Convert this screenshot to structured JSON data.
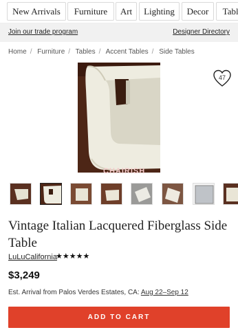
{
  "categories": [
    "New Arrivals",
    "Furniture",
    "Art",
    "Lighting",
    "Decor",
    "Table"
  ],
  "trade_bar": {
    "left_link": "Join our trade program",
    "right_link": "Designer Directory"
  },
  "breadcrumb": [
    "Home",
    "Furniture",
    "Tables",
    "Accent Tables",
    "Side Tables"
  ],
  "favorite": {
    "count": "47"
  },
  "watermark": "CHAIRISH",
  "product": {
    "title": "Vintage Italian Lacquered Fiberglass Side Table",
    "seller": "LuLuCalifornia",
    "rating_stars": "★★★★★",
    "price": "$3,249",
    "arrival_prefix": "Est. Arrival from Palos Verdes Estates, CA:",
    "arrival_dates": "Aug 22–Sep 12"
  },
  "cta": {
    "add_to_cart": "ADD TO CART"
  },
  "colors": {
    "accent": "#e0412a",
    "hero_bg": "#4a2415"
  }
}
